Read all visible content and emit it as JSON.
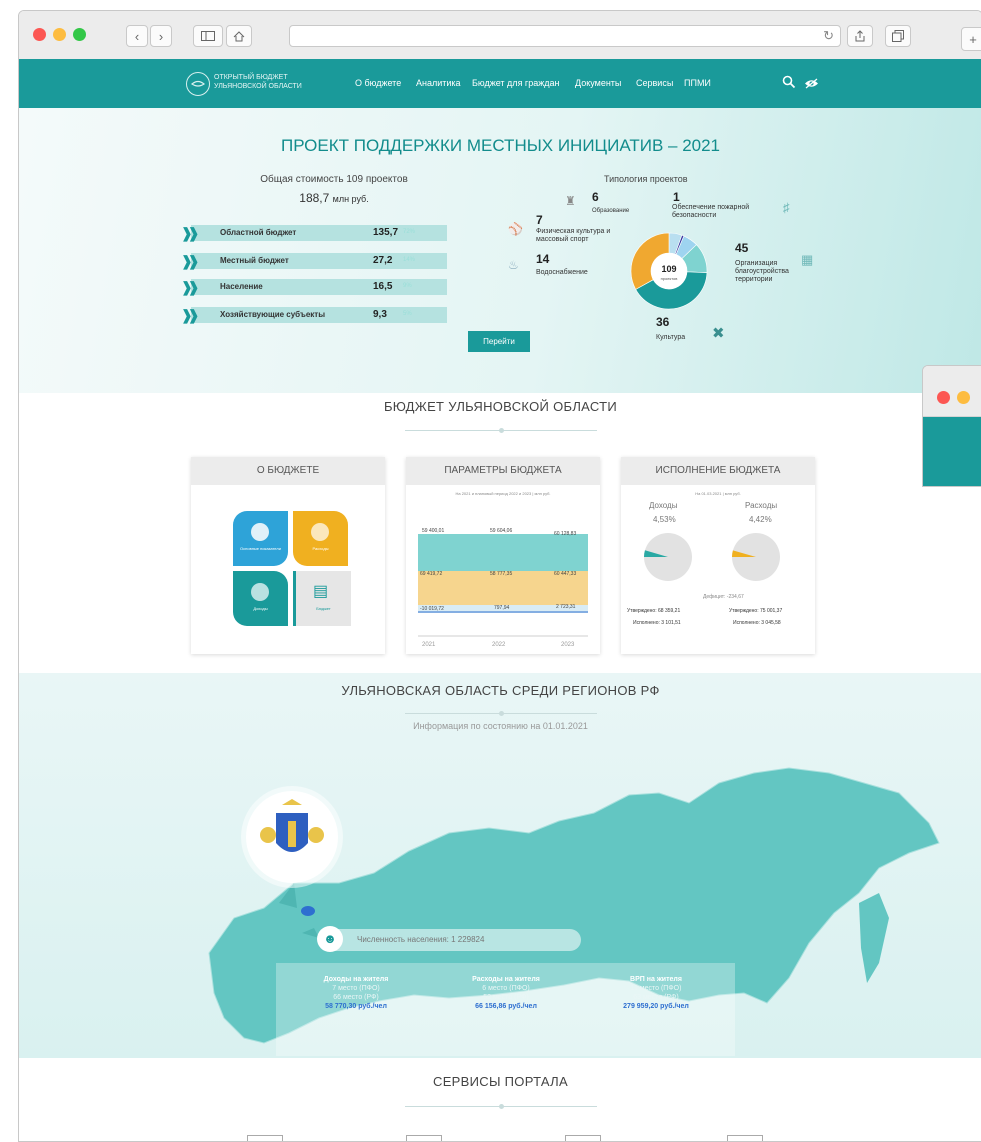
{
  "nav": {
    "logo_line1": "ОТКРЫТЫЙ БЮДЖЕТ",
    "logo_line2": "УЛЬЯНОВСКОЙ ОБЛАСТИ",
    "items": [
      "О бюджете",
      "Аналитика",
      "Бюджет для граждан",
      "Документы",
      "Сервисы",
      "ППМИ"
    ]
  },
  "hero": {
    "title": "ПРОЕКТ ПОДДЕРЖКИ МЕСТНЫХ ИНИЦИАТИВ – 2021",
    "total_caption": "Общая стоимость 109 проектов",
    "total_amount": "188,7",
    "total_unit": "млн руб.",
    "button_label": "Перейти",
    "typology_title": "Типология проектов",
    "donut_center_value": "109",
    "donut_center_label": "проектов"
  },
  "chart_data": [
    {
      "type": "bar",
      "categories": [
        "Областной бюджет",
        "Местный бюджет",
        "Население",
        "Хозяйствующие субъекты"
      ],
      "values": [
        135.7,
        27.2,
        16.5,
        9.3
      ],
      "value_labels": [
        "135,7",
        "27,2",
        "16,5",
        "9,3"
      ],
      "percent_labels": [
        "72%",
        "14%",
        "9%",
        "5%"
      ]
    },
    {
      "type": "pie",
      "title": "Типология проектов",
      "categories": [
        "Образование",
        "Обеспечение пожарной безопасности",
        "Физическая культура и массовый спорт",
        "Водоснабжение",
        "Организация благоустройства территории",
        "Культура"
      ],
      "values": [
        6,
        1,
        7,
        14,
        45,
        36
      ],
      "colors": [
        "#b9dff0",
        "#3b3aa0",
        "#9ed4f0",
        "#7fd3d0",
        "#1a9a9a",
        "#f0a830"
      ]
    }
  ],
  "budget_section": {
    "title": "БЮДЖЕТ УЛЬЯНОВСКОЙ ОБЛАСТИ",
    "card1": {
      "title": "О БЮДЖЕТЕ",
      "tiles": [
        "Основные показатели",
        "Расходы",
        "Доходы",
        "Бюджет"
      ]
    },
    "card2": {
      "title": "ПАРАМЕТРЫ БЮДЖЕТА",
      "subtitle": "На 2021 и плановый период 2022 и 2023 | млн руб.",
      "years": [
        "2021",
        "2022",
        "2023"
      ],
      "rows": [
        [
          "59 400,01",
          "59 604,06",
          "60 128,83"
        ],
        [
          "69 419,72",
          "58 777,35",
          "60 447,33"
        ],
        [
          "-10 019,72",
          "797,94",
          "2 723,31"
        ]
      ]
    },
    "card3": {
      "title": "ИСПОЛНЕНИЕ БЮДЖЕТА",
      "subtitle": "На 01.03.2021 | млн руб.",
      "income_label": "Доходы",
      "income_pct": "4,53%",
      "expense_label": "Расходы",
      "expense_pct": "4,42%",
      "deficit": "Дефицит: -234,67",
      "income_approved": "Утверждено: 68 359,21",
      "income_executed": "Исполнено: 3 101,51",
      "expense_approved": "Утверждено: 75 001,37",
      "expense_executed": "Исполнено: 3 045,58"
    }
  },
  "regions_section": {
    "title": "УЛЬЯНОВСКАЯ ОБЛАСТЬ СРЕДИ РЕГИОНОВ РФ",
    "subtitle": "Информация по состоянию на 01.01.2021",
    "population": "Численность населения: 1 229824",
    "stats": [
      {
        "title": "Доходы на жителя",
        "rank1": "7 место (ПФО)",
        "rank2": "66 место (РФ)",
        "value": "58 770,30 руб./чел"
      },
      {
        "title": "Расходы на жителя",
        "rank1": "6 место (ПФО)",
        "rank2": "52 место (РФ)",
        "value": "66 156,86 руб./чел"
      },
      {
        "title": "ВРП на жителя",
        "rank1": "11 место (ПФО)",
        "rank2": "63 место (РФ)",
        "value": "279 959,20 руб./чел"
      }
    ]
  },
  "services_section": {
    "title": "СЕРВИСЫ ПОРТАЛА"
  },
  "colors": {
    "accent": "#1a9a9a",
    "orange": "#f0a830",
    "light_teal": "#7fd3d0"
  }
}
